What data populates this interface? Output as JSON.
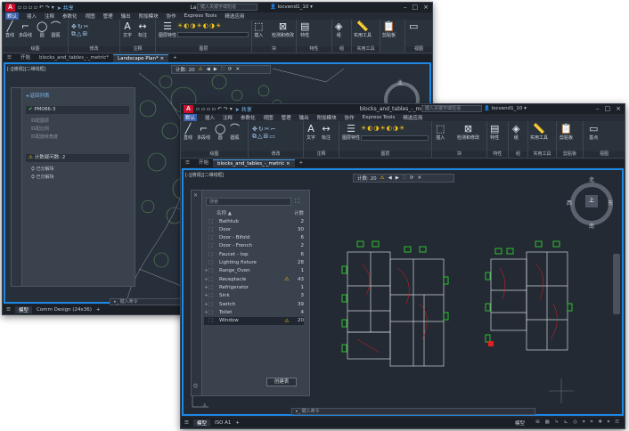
{
  "back": {
    "title": "Landscape Plan.dwg",
    "search_placeholder": "键入关键字或短语",
    "user": "locvend1_10",
    "share": "共享",
    "menus": [
      "默认",
      "插入",
      "注释",
      "参数化",
      "视图",
      "管理",
      "输出",
      "附加模块",
      "协作",
      "Express Tools",
      "精选应用"
    ],
    "tools": [
      "直线",
      "多段线",
      "圆",
      "圆弧",
      "文字",
      "标注",
      "图层特性",
      "插入",
      "检测和修改",
      "特性",
      "组",
      "实用工具",
      "剪贴板",
      "视图"
    ],
    "groups": [
      "绘图",
      "修改",
      "注释",
      "图层",
      "块",
      "特性",
      "组",
      "实用工具",
      "视图"
    ],
    "tabs": [
      "开始",
      "blocks_and_tables_-_metric*",
      "Landscape Plan*"
    ],
    "viewport_label": "[-][俯视][二维线框]",
    "countbar": {
      "label": "计数: 20"
    },
    "panel": {
      "header": "返回列表",
      "section1": "PM086-3",
      "section1_items": [
        "匹配图层",
        "匹配比例",
        "匹配旋转角度"
      ],
      "section2": "计数疑问数: 2",
      "section2_items": [
        "已分解块",
        "已分解块"
      ]
    },
    "status_tabs": [
      "模型",
      "Comm Design (24x36)"
    ],
    "cmd_placeholder": "键入命令"
  },
  "front": {
    "title": "blocks_and_tables_-_metric.dwg",
    "search_placeholder": "键入关键字或短语",
    "user": "locvend1_10",
    "share": "共享",
    "menus": [
      "默认",
      "插入",
      "注释",
      "参数化",
      "视图",
      "管理",
      "输出",
      "附加模块",
      "协作",
      "Express Tools",
      "精选应用"
    ],
    "tools": [
      "直线",
      "多段线",
      "圆",
      "圆弧",
      "文字",
      "标注",
      "图层特性",
      "插入",
      "检测和修改",
      "特性",
      "组",
      "实用工具",
      "剪贴板",
      "基点"
    ],
    "groups": [
      "绘图",
      "修改",
      "注释",
      "图层",
      "块",
      "特性",
      "组",
      "实用工具",
      "剪贴板",
      "视图"
    ],
    "tabs": [
      "开始",
      "blocks_and_tables_-_metric"
    ],
    "viewport_label": "[-][俯视][二维线框]",
    "countbar": {
      "label": "计数: 20"
    },
    "compass": {
      "n": "北",
      "s": "南",
      "w": "西",
      "e": "东",
      "center": "上"
    },
    "panel": {
      "search_placeholder": "搜索",
      "col_name": "名称 ▲",
      "col_count": "计数",
      "rows": [
        {
          "name": "Bathtub",
          "count": "2",
          "expand": false,
          "warn": false
        },
        {
          "name": "Door",
          "count": "30",
          "expand": false,
          "warn": false
        },
        {
          "name": "Door - Bifold",
          "count": "6",
          "expand": false,
          "warn": false
        },
        {
          "name": "Door - French",
          "count": "2",
          "expand": false,
          "warn": false
        },
        {
          "name": "Faucet - top",
          "count": "6",
          "expand": false,
          "warn": false
        },
        {
          "name": "Lighting fixture",
          "count": "28",
          "expand": false,
          "warn": false
        },
        {
          "name": "Range_Oven",
          "count": "1",
          "expand": true,
          "warn": false
        },
        {
          "name": "Receptacle",
          "count": "43",
          "expand": true,
          "warn": true
        },
        {
          "name": "Refrigerator",
          "count": "1",
          "expand": true,
          "warn": false
        },
        {
          "name": "Sink",
          "count": "3",
          "expand": true,
          "warn": false
        },
        {
          "name": "Switch",
          "count": "39",
          "expand": true,
          "warn": false
        },
        {
          "name": "Toilet",
          "count": "4",
          "expand": true,
          "warn": false
        },
        {
          "name": "Window",
          "count": "20",
          "expand": false,
          "warn": true
        }
      ],
      "button": "创建表"
    },
    "status_tabs": [
      "模型",
      "ISO A1"
    ],
    "status_right": "模型",
    "cmd_placeholder": "键入命令"
  },
  "colors": {
    "accent": "#1e88e5",
    "brand": "#c8102e",
    "warning": "#f5c518",
    "green": "#22dd22",
    "red": "#e02020"
  }
}
